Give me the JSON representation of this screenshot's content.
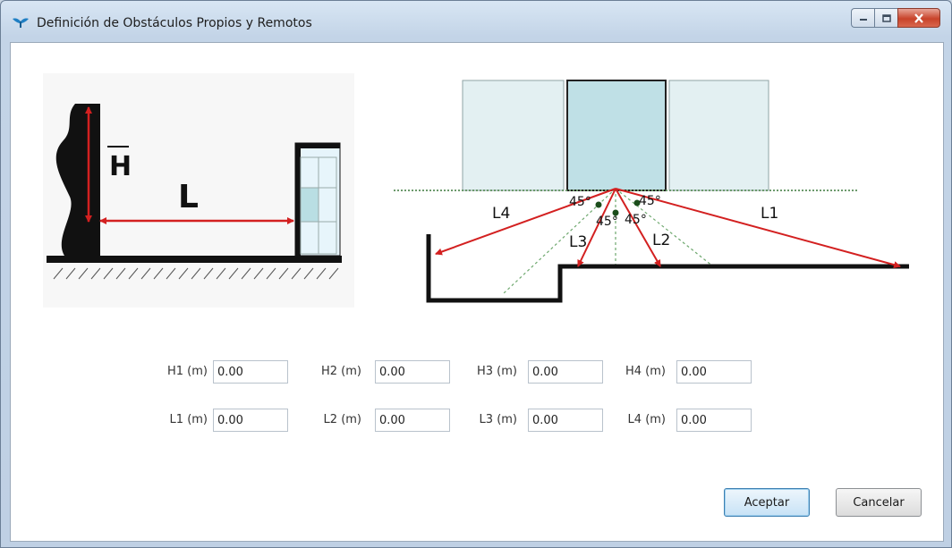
{
  "window": {
    "title": "Definición de Obstáculos Propios y Remotos"
  },
  "diagram_left": {
    "height_label": "H",
    "length_label": "L"
  },
  "diagram_right": {
    "line_labels": [
      "L1",
      "L2",
      "L3",
      "L4"
    ],
    "angle_labels": [
      "45°",
      "45°",
      "45°",
      "45°"
    ]
  },
  "fields": {
    "row_h": [
      {
        "label": "H1 (m)",
        "value": "0.00"
      },
      {
        "label": "H2 (m)",
        "value": "0.00"
      },
      {
        "label": "H3 (m)",
        "value": "0.00"
      },
      {
        "label": "H4 (m)",
        "value": "0.00"
      }
    ],
    "row_l": [
      {
        "label": "L1 (m)",
        "value": "0.00"
      },
      {
        "label": "L2 (m)",
        "value": "0.00"
      },
      {
        "label": "L3 (m)",
        "value": "0.00"
      },
      {
        "label": "L4 (m)",
        "value": "0.00"
      }
    ]
  },
  "buttons": {
    "accept": "Aceptar",
    "cancel": "Cancelar"
  },
  "icons": {
    "app": "wings-icon",
    "minimize": "minimize-icon",
    "maximize": "maximize-icon",
    "close": "close-icon"
  },
  "colors": {
    "accent_red": "#d32020",
    "glass_fill": "#bfe0e6",
    "close_button": "#c8432a"
  }
}
